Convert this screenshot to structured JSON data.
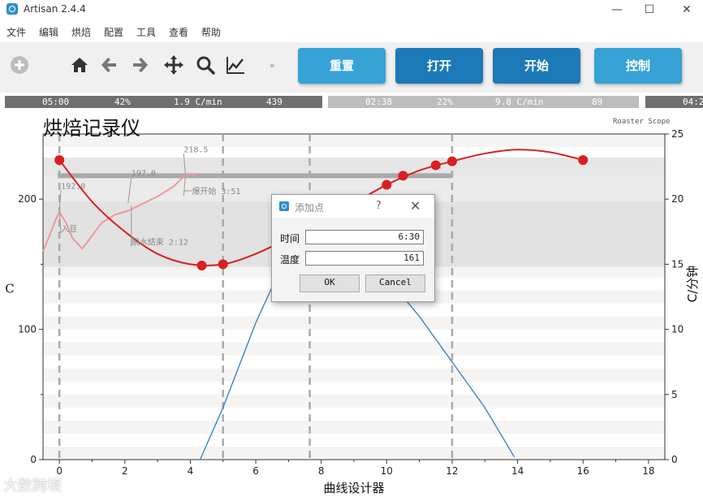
{
  "window": {
    "title": "Artisan 2.4.4",
    "minimize_glyph": "—",
    "maximize_glyph": "☐",
    "close_glyph": "✕"
  },
  "menu": [
    "文件",
    "编辑",
    "烘焙",
    "配置",
    "工具",
    "查看",
    "帮助"
  ],
  "toolbar": {
    "icons": [
      "plus-circle-icon",
      "home-icon",
      "back-arrow-icon",
      "forward-arrow-icon",
      "move-icon",
      "zoom-icon",
      "line-chart-icon"
    ],
    "more_glyph": "»",
    "buttons": [
      {
        "label": "重置",
        "color": "#36a2d6"
      },
      {
        "label": "打开",
        "color": "#1c7ab8"
      },
      {
        "label": "开始",
        "color": "#1c7ab8"
      },
      {
        "label": "控制",
        "color": "#36a2d6"
      }
    ]
  },
  "lcd": [
    {
      "time": "05:00",
      "pct": "42%",
      "ror": "1.9 C/min",
      "val": "439",
      "bg": "#6f6f6f"
    },
    {
      "time": "02:38",
      "pct": "22%",
      "ror": "9.8 C/min",
      "val": "89",
      "bg": "#bdbdbd"
    },
    {
      "time": "04:2",
      "bg": "#6f6f6f"
    }
  ],
  "chart_title": "烘焙记录仪",
  "roaster_scope": "Roaster Scope",
  "chart_data": {
    "type": "line",
    "xlabel": "曲线设计器",
    "ylabel_left": "C",
    "ylabel_right": "C/分钟",
    "xlim": [
      -0.5,
      18.5
    ],
    "ylim_left": [
      0,
      250
    ],
    "ylim_right": [
      0,
      25
    ],
    "xticks": [
      0,
      2,
      4,
      6,
      8,
      10,
      12,
      14,
      16,
      18
    ],
    "yticks_left": [
      0,
      100,
      200
    ],
    "yticks_right": [
      0,
      5,
      10,
      15,
      20,
      25
    ],
    "phase_lines_x": [
      0,
      5,
      7.65,
      12
    ],
    "bands": [
      {
        "y_from": 218,
        "y_to": 232,
        "color": "#e6e6e6"
      },
      {
        "y_from": 198,
        "y_to": 218,
        "color": "#ebebeb"
      },
      {
        "y_from": 148,
        "y_to": 198,
        "color": "#e2e2e2"
      }
    ],
    "designer_points": [
      {
        "x": 0,
        "y": 230
      },
      {
        "x": 4.35,
        "y": 149
      },
      {
        "x": 5,
        "y": 150
      },
      {
        "x": 10,
        "y": 211
      },
      {
        "x": 10.5,
        "y": 218
      },
      {
        "x": 11.5,
        "y": 226
      },
      {
        "x": 12,
        "y": 229
      },
      {
        "x": 16,
        "y": 230
      }
    ],
    "designer_curve": [
      [
        0,
        230
      ],
      [
        1,
        198
      ],
      [
        2,
        175
      ],
      [
        3,
        158
      ],
      [
        4,
        150
      ],
      [
        5,
        150
      ],
      [
        6,
        158
      ],
      [
        7,
        170
      ],
      [
        8,
        183
      ],
      [
        9,
        197
      ],
      [
        10,
        211
      ],
      [
        11,
        222
      ],
      [
        12,
        229
      ],
      [
        13,
        235
      ],
      [
        14,
        238
      ],
      [
        15,
        236
      ],
      [
        16,
        230
      ]
    ],
    "et_curve": [
      [
        -0.5,
        160
      ],
      [
        -0.3,
        172
      ],
      [
        -0.1,
        185
      ],
      [
        0,
        190
      ],
      [
        0.2,
        182
      ],
      [
        0.4,
        170
      ],
      [
        0.7,
        162
      ],
      [
        1,
        172
      ],
      [
        1.3,
        182
      ],
      [
        1.7,
        188
      ],
      [
        2.1,
        191
      ],
      [
        2.5,
        196
      ],
      [
        3,
        202
      ],
      [
        3.5,
        210
      ],
      [
        3.85,
        218.5
      ],
      [
        4,
        219
      ],
      [
        4.2,
        218
      ]
    ],
    "ror_curve": [
      [
        4.3,
        0
      ],
      [
        5,
        4
      ],
      [
        6,
        10.5
      ],
      [
        7,
        16
      ],
      [
        7.5,
        18
      ],
      [
        8,
        19
      ],
      [
        8.8,
        17
      ],
      [
        10,
        14
      ],
      [
        11,
        11
      ],
      [
        12,
        7.5
      ],
      [
        13,
        4
      ],
      [
        13.9,
        0.2
      ]
    ],
    "annotations": [
      {
        "text": "192.0",
        "x": 0,
        "y": 192,
        "label_x": 0.05,
        "label_y": 208
      },
      {
        "text": "入豆",
        "x": 0,
        "y": 190,
        "label_x": 0.05,
        "label_y": 175
      },
      {
        "text": "197.0",
        "x": 2.1,
        "y": 197,
        "label_x": 2.2,
        "label_y": 218
      },
      {
        "text": "脱水结束 2:12",
        "x": 2.2,
        "y": 195,
        "label_x": 2.2,
        "label_y": 165
      },
      {
        "text": "218.5",
        "x": 3.85,
        "y": 218.5,
        "label_x": 3.8,
        "label_y": 236
      },
      {
        "text": "一爆开始 3:51",
        "x": 3.85,
        "y": 218,
        "label_x": 3.8,
        "label_y": 204
      }
    ],
    "series": [
      {
        "name": "designer",
        "color": "#d91f1f"
      },
      {
        "name": "et",
        "color": "#ef9a9a"
      },
      {
        "name": "ror",
        "color": "#3a86c8"
      }
    ]
  },
  "dialog": {
    "title": "添加点",
    "help": "?",
    "close": "✕",
    "time_label": "时间",
    "time_value": "6:30",
    "temp_label": "温度",
    "temp_value": "161",
    "ok": "OK",
    "cancel": "Cancel"
  },
  "watermark": "大数跨境"
}
